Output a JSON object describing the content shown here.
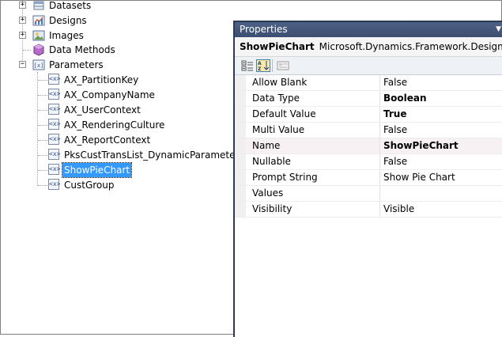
{
  "tree": {
    "items": [
      {
        "label": "Datasets",
        "icon": "datasets-icon",
        "expander": "+"
      },
      {
        "label": "Designs",
        "icon": "designs-icon",
        "expander": "+"
      },
      {
        "label": "Images",
        "icon": "images-icon",
        "expander": "+"
      },
      {
        "label": "Data Methods",
        "icon": "data-methods-icon",
        "expander": ""
      },
      {
        "label": "Parameters",
        "icon": "parameters-icon",
        "expander": "−"
      }
    ],
    "parameters": [
      {
        "label": "AX_PartitionKey"
      },
      {
        "label": "AX_CompanyName"
      },
      {
        "label": "AX_UserContext"
      },
      {
        "label": "AX_RenderingCulture"
      },
      {
        "label": "AX_ReportContext"
      },
      {
        "label": "PksCustTransList_DynamicParameter"
      },
      {
        "label": "ShowPieChart",
        "selected": true
      },
      {
        "label": "CustGroup"
      }
    ]
  },
  "properties": {
    "title": "Properties",
    "object_name": "ShowPieChart",
    "object_type": "Microsoft.Dynamics.Framework.Design.Model.",
    "rows": [
      {
        "name": "Allow Blank",
        "value": "False",
        "bold": false
      },
      {
        "name": "Data Type",
        "value": "Boolean",
        "bold": true
      },
      {
        "name": "Default Value",
        "value": "True",
        "bold": true
      },
      {
        "name": "Multi Value",
        "value": "False",
        "bold": false
      },
      {
        "name": "Name",
        "value": "ShowPieChart",
        "bold": true
      },
      {
        "name": "Nullable",
        "value": "False",
        "bold": false
      },
      {
        "name": "Prompt String",
        "value": "Show Pie Chart",
        "bold": false
      },
      {
        "name": "Values",
        "value": "",
        "bold": false
      },
      {
        "name": "Visibility",
        "value": "Visible",
        "bold": false
      }
    ]
  },
  "colors": {
    "selection": "#3399ff",
    "panel_border": "#2b3a55",
    "title_bar": "#4d6185"
  }
}
